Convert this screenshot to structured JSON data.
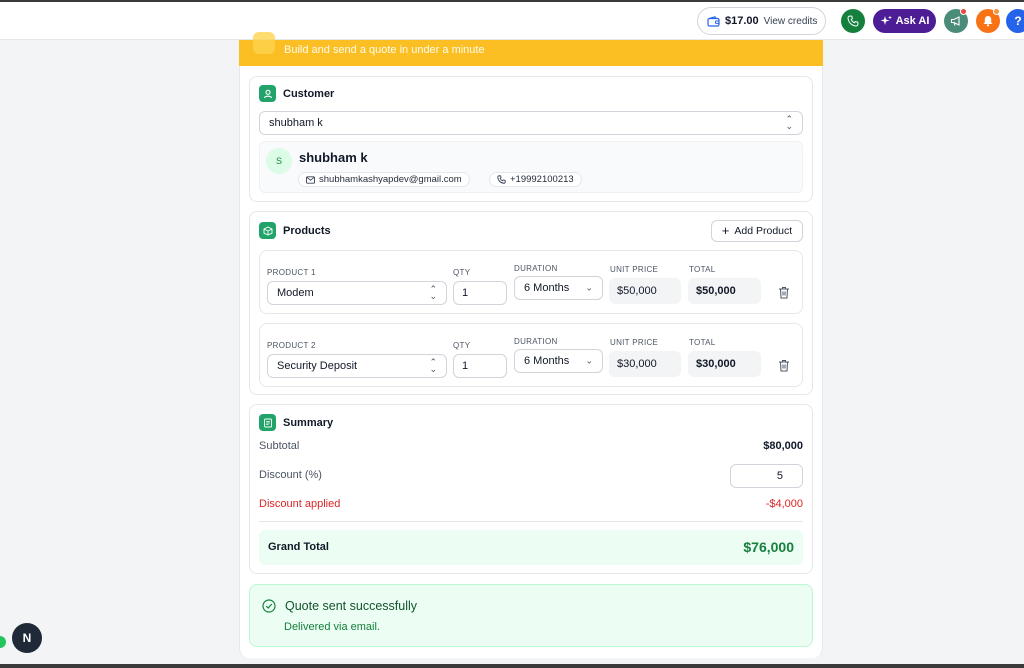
{
  "topbar": {
    "credits_amount": "$17.00",
    "credits_label": "View credits",
    "ask_ai_label": "Ask AI",
    "help_glyph": "?"
  },
  "banner": {
    "subtitle": "Build and send a quote in under a minute"
  },
  "customer": {
    "section_title": "Customer",
    "selected": "shubham k",
    "avatar_initial": "S",
    "name": "shubham k",
    "email": "shubhamkashyapdev@gmail.com",
    "phone": "+19992100213"
  },
  "products": {
    "section_title": "Products",
    "add_button": "Add Product",
    "labels": {
      "qty": "QTY",
      "duration": "DURATION",
      "unit_price": "UNIT PRICE",
      "total": "TOTAL"
    },
    "items": [
      {
        "label": "PRODUCT 1",
        "name": "Modem",
        "qty": "1",
        "duration": "6 Months",
        "unit_price": "$50,000",
        "total": "$50,000"
      },
      {
        "label": "PRODUCT 2",
        "name": "Security Deposit",
        "qty": "1",
        "duration": "6 Months",
        "unit_price": "$30,000",
        "total": "$30,000"
      }
    ]
  },
  "summary": {
    "section_title": "Summary",
    "subtotal_label": "Subtotal",
    "subtotal_value": "$80,000",
    "discount_label": "Discount (%)",
    "discount_value": "5",
    "discount_applied_label": "Discount applied",
    "discount_applied_value": "-$4,000",
    "grand_total_label": "Grand Total",
    "grand_total_value": "$76,000"
  },
  "status": {
    "title": "Quote sent successfully",
    "detail": "Delivered via email."
  },
  "dev_badge": "N",
  "colors": {
    "accent_green": "#22a36a",
    "banner_yellow": "#fbbf24",
    "ask_ai_purple": "#4c1d95",
    "danger_red": "#dc2626",
    "success_bg": "#ecfdf3"
  }
}
